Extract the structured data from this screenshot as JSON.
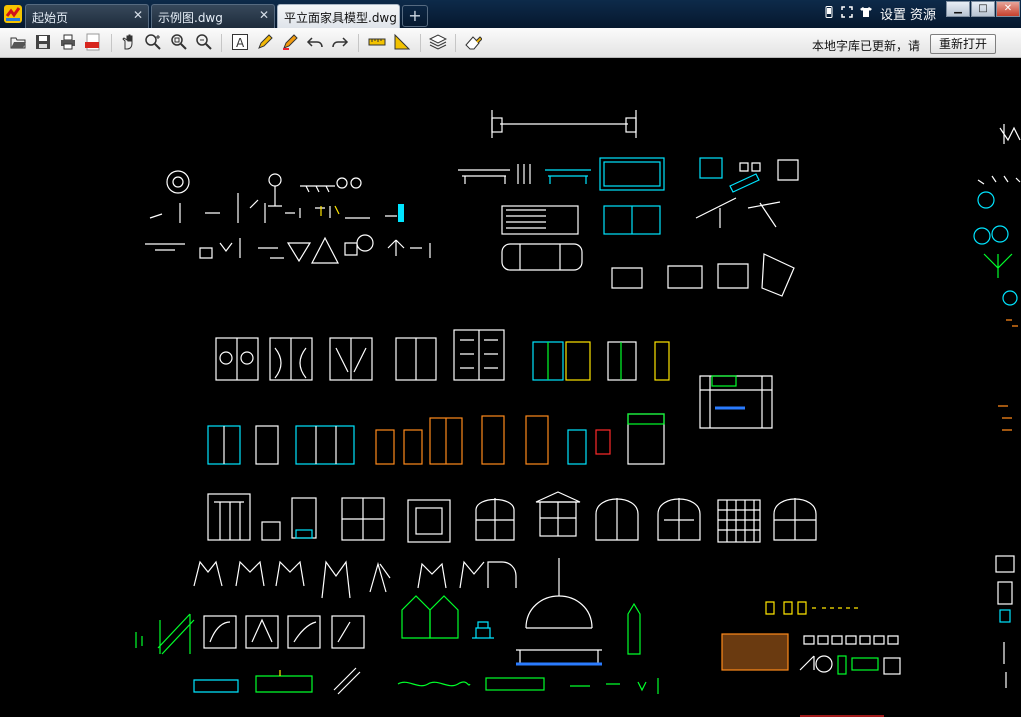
{
  "tabs": [
    {
      "label": "起始页",
      "active": false
    },
    {
      "label": "示例图.dwg",
      "active": false
    },
    {
      "label": "平立面家具模型.dwg",
      "active": true
    }
  ],
  "new_tab_symbol": "+",
  "top_right": {
    "settings_label": "设置",
    "resources_label": "资源",
    "icons": [
      "phone-icon",
      "fullscreen-icon",
      "shirt-icon"
    ]
  },
  "window_controls": [
    "minimize-icon",
    "maximize-icon",
    "close-icon"
  ],
  "toolbar": {
    "tools": [
      "open-icon",
      "save-icon",
      "print-icon",
      "pdf-icon",
      "pan-icon",
      "zoom-realtime-icon",
      "zoom-window-icon",
      "zoom-extents-icon",
      "text-icon",
      "pencil-icon",
      "highlighter-icon",
      "undo-icon",
      "redo-icon",
      "measure-icon",
      "area-measure-icon",
      "layers-icon",
      "eraser-icon"
    ],
    "notice": "本地字库已更新，请",
    "reopen_label": "重新打开"
  },
  "colors": {
    "drawing_bg": "#000000",
    "line": "#ffffff",
    "cyan": "#00e5ff",
    "green": "#00ff2a",
    "orange": "#ff8a1a",
    "yellow": "#ffe600",
    "magenta": "#ff2bd6",
    "red": "#ff2a2a"
  }
}
